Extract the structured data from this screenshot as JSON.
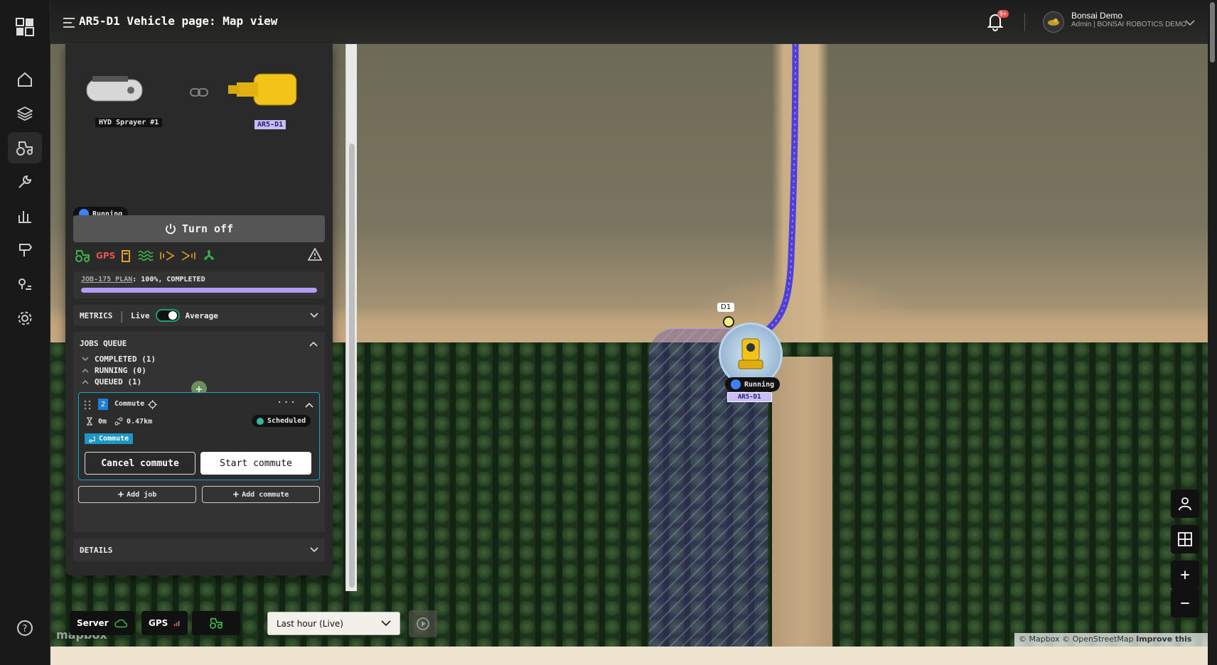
{
  "header": {
    "title": "AR5-D1 Vehicle page: Map view",
    "notif_badge": "9+",
    "user_name": "Bonsai Demo",
    "user_role": "Admin | BONSAI ROBOTICS DEMO"
  },
  "implement": {
    "left_name": "HYD Sprayer #1",
    "right_name": "AR5-D1"
  },
  "status": {
    "state": "Running",
    "turn_off_label": "Turn off",
    "gps_label": "GPS"
  },
  "job": {
    "plan_link": "JOB-175 PLAN",
    "plan_status": ": 100%, COMPLETED",
    "progress": 1.0
  },
  "metrics": {
    "title": "METRICS",
    "live": "Live",
    "average": "Average"
  },
  "queue": {
    "title": "JOBS QUEUE",
    "completed": "COMPLETED (1)",
    "running": "RUNNING (0)",
    "queued": "QUEUED (1)",
    "card": {
      "index": "2",
      "name": "Commute",
      "duration": "0m",
      "distance": "0.47km",
      "state": "Scheduled",
      "tag": "Commute",
      "cancel": "Cancel commute",
      "start": "Start commute"
    },
    "add_job": "Add job",
    "add_commute": "Add commute"
  },
  "details": {
    "title": "DETAILS"
  },
  "map": {
    "marker_label": "D1",
    "vehicle_state": "Running",
    "vehicle_name": "AR5-D1",
    "attribution": "© Mapbox © OpenStreetMap",
    "improve": "Improve this map",
    "logo": "mapbox"
  },
  "bottom": {
    "server": "Server",
    "gps": "GPS",
    "time_range": "Last hour (Live)"
  },
  "colors": {
    "accent": "#a78bfa",
    "path": "#4f3fd6",
    "running": "#3b82f6",
    "teal": "#0ea5c6"
  }
}
